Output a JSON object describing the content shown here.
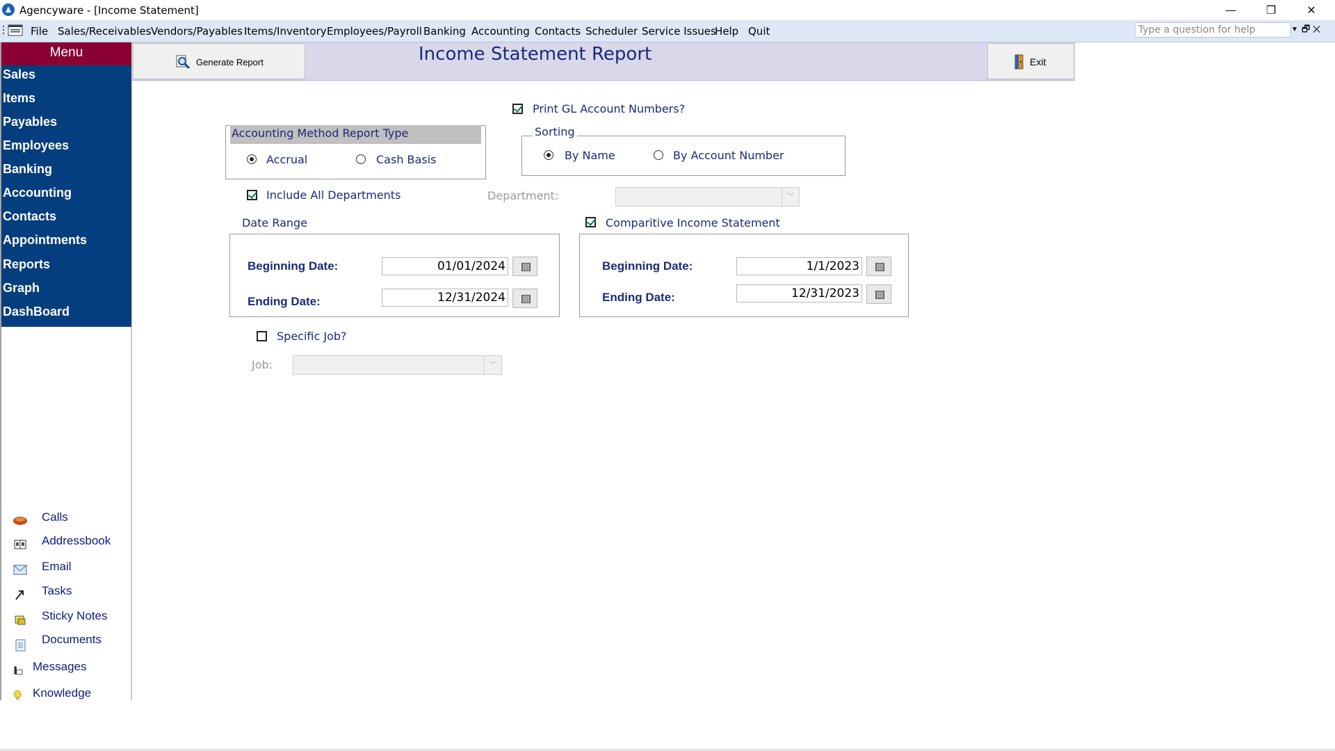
{
  "window": {
    "title": "Agencyware - [Income Statement]",
    "controls": {
      "minimize": "—",
      "restore": "❐",
      "close": "✕"
    }
  },
  "menubar": {
    "items": [
      "File",
      "Sales/Receivables",
      "Vendors/Payables",
      "Items/Inventory",
      "Employees/Payroll",
      "Banking",
      "Accounting",
      "Contacts",
      "Scheduler",
      "Service Issues",
      "Help",
      "Quit"
    ],
    "help_placeholder": "Type a question for help",
    "mdi_controls": "🗗 ✕"
  },
  "sidebar": {
    "header": "Menu",
    "nav": [
      "Sales",
      "Items",
      "Payables",
      "Employees",
      "Banking",
      "Accounting",
      "Contacts",
      "Appointments",
      "Reports",
      "Graph",
      "DashBoard"
    ],
    "tools": [
      {
        "label": "Calls",
        "icon": "phone-icon"
      },
      {
        "label": "Addressbook",
        "icon": "addressbook-icon"
      },
      {
        "label": "Email",
        "icon": "email-icon"
      },
      {
        "label": "Tasks",
        "icon": "tasks-icon"
      },
      {
        "label": "Sticky Notes",
        "icon": "sticky-notes-icon"
      },
      {
        "label": "Documents",
        "icon": "documents-icon"
      },
      {
        "label": "Messages",
        "icon": "messages-icon"
      },
      {
        "label": "Knowledge",
        "icon": "lightbulb-icon"
      }
    ]
  },
  "header": {
    "generate_label": "Generate Report",
    "title": "Income Statement  Report",
    "exit_label": "Exit"
  },
  "form": {
    "print_gl": "Print GL Account Numbers?",
    "method": {
      "title": "Accounting Method Report Type",
      "accrual": "Accrual",
      "cash": "Cash Basis"
    },
    "sorting": {
      "title": "Sorting",
      "by_name": "By Name",
      "by_number": "By Account Number"
    },
    "include_departments": "Include All Departments",
    "department_label": "Department:",
    "date_range": {
      "title": "Date Range",
      "begin_label": "Beginning Date:",
      "end_label": "Ending Date:",
      "begin": "01/01/2024",
      "end": "12/31/2024"
    },
    "comparative": {
      "title": "Comparitive Income Statement",
      "begin_label": "Beginning Date:",
      "end_label": "Ending Date:",
      "begin": "1/1/2023",
      "end": "12/31/2023"
    },
    "specific_job": "Specific Job?",
    "job_label": "Job:"
  }
}
